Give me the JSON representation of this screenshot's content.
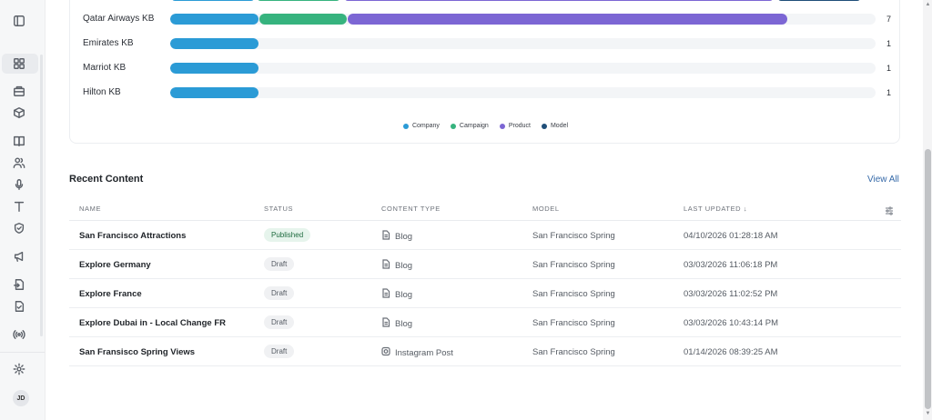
{
  "sidebar": {
    "icons": [
      {
        "name": "panel-toggle-icon"
      },
      {
        "name": "dashboard-icon"
      },
      {
        "name": "building-icon"
      },
      {
        "name": "box-icon"
      },
      {
        "name": "book-icon"
      },
      {
        "name": "users-icon"
      },
      {
        "name": "microphone-icon"
      },
      {
        "name": "text-icon"
      },
      {
        "name": "shield-icon"
      },
      {
        "name": "megaphone-icon"
      },
      {
        "name": "file-import-icon"
      },
      {
        "name": "file-check-icon"
      },
      {
        "name": "broadcast-icon"
      },
      {
        "name": "gear-icon"
      }
    ],
    "avatar_initials": "JD"
  },
  "kb_chart": {
    "rows": [
      {
        "label": "Qatar Airways KB",
        "count": "7",
        "segments": [
          {
            "series": "Company",
            "value": 1
          },
          {
            "series": "Campaign",
            "value": 1
          },
          {
            "series": "Product",
            "value": 5
          }
        ]
      },
      {
        "label": "Emirates KB",
        "count": "1",
        "segments": [
          {
            "series": "Company",
            "value": 1
          }
        ]
      },
      {
        "label": "Marriot KB",
        "count": "1",
        "segments": [
          {
            "series": "Company",
            "value": 1
          }
        ]
      },
      {
        "label": "Hilton KB",
        "count": "1",
        "segments": [
          {
            "series": "Company",
            "value": 1
          }
        ]
      }
    ],
    "max_total": 8,
    "legend": [
      {
        "label": "Company",
        "color": "#2b9bd6"
      },
      {
        "label": "Campaign",
        "color": "#36b37e"
      },
      {
        "label": "Product",
        "color": "#7c66d4"
      },
      {
        "label": "Model",
        "color": "#1f4e79"
      }
    ]
  },
  "recent_content": {
    "title": "Recent Content",
    "view_all_label": "View All",
    "columns": [
      "NAME",
      "STATUS",
      "CONTENT TYPE",
      "MODEL",
      "LAST UPDATED ↓"
    ],
    "rows": [
      {
        "name": "San Francisco Attractions",
        "status": "Published",
        "content_type": "Blog",
        "type_icon": "document-icon",
        "model": "San Francisco Spring",
        "last_updated": "04/10/2026 01:28:18 AM"
      },
      {
        "name": "Explore Germany",
        "status": "Draft",
        "content_type": "Blog",
        "type_icon": "document-icon",
        "model": "San Francisco Spring",
        "last_updated": "03/03/2026 11:06:18 PM"
      },
      {
        "name": "Explore France",
        "status": "Draft",
        "content_type": "Blog",
        "type_icon": "document-icon",
        "model": "San Francisco Spring",
        "last_updated": "03/03/2026 11:02:52 PM"
      },
      {
        "name": "Explore Dubai in - Local Change FR",
        "status": "Draft",
        "content_type": "Blog",
        "type_icon": "document-icon",
        "model": "San Francisco Spring",
        "last_updated": "03/03/2026 10:43:14 PM"
      },
      {
        "name": "San Fransisco Spring Views",
        "status": "Draft",
        "content_type": "Instagram Post",
        "type_icon": "instagram-icon",
        "model": "San Francisco Spring",
        "last_updated": "01/14/2026 08:39:25 AM"
      }
    ]
  }
}
